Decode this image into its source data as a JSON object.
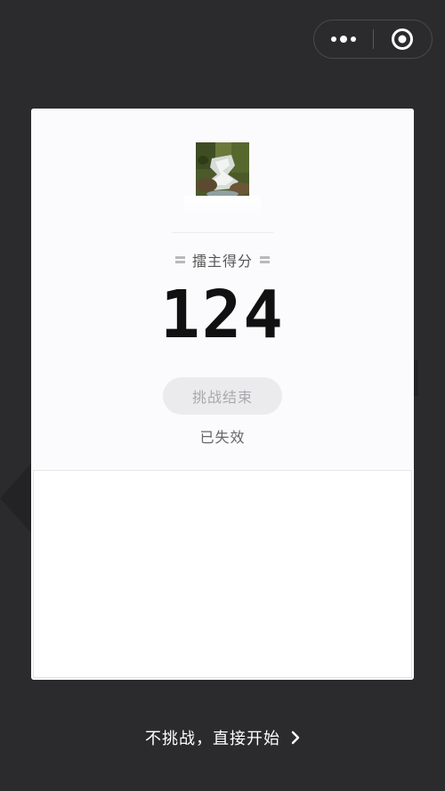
{
  "capsule": {
    "more_icon": "more-dots-icon",
    "close_icon": "target-circle-icon"
  },
  "card": {
    "avatar_icon": "waterfall-photo",
    "score_title": "擂主得分",
    "score_value": "124",
    "ended_button_label": "挑战结束",
    "status_text": "已失效"
  },
  "footer": {
    "skip_label": "不挑战，直接开始",
    "chevron_icon": "chevron-right-icon"
  },
  "colors": {
    "background": "#2b2b2d",
    "card": "#ffffff",
    "score": "#111111",
    "disabled_button": "#ebebed"
  }
}
